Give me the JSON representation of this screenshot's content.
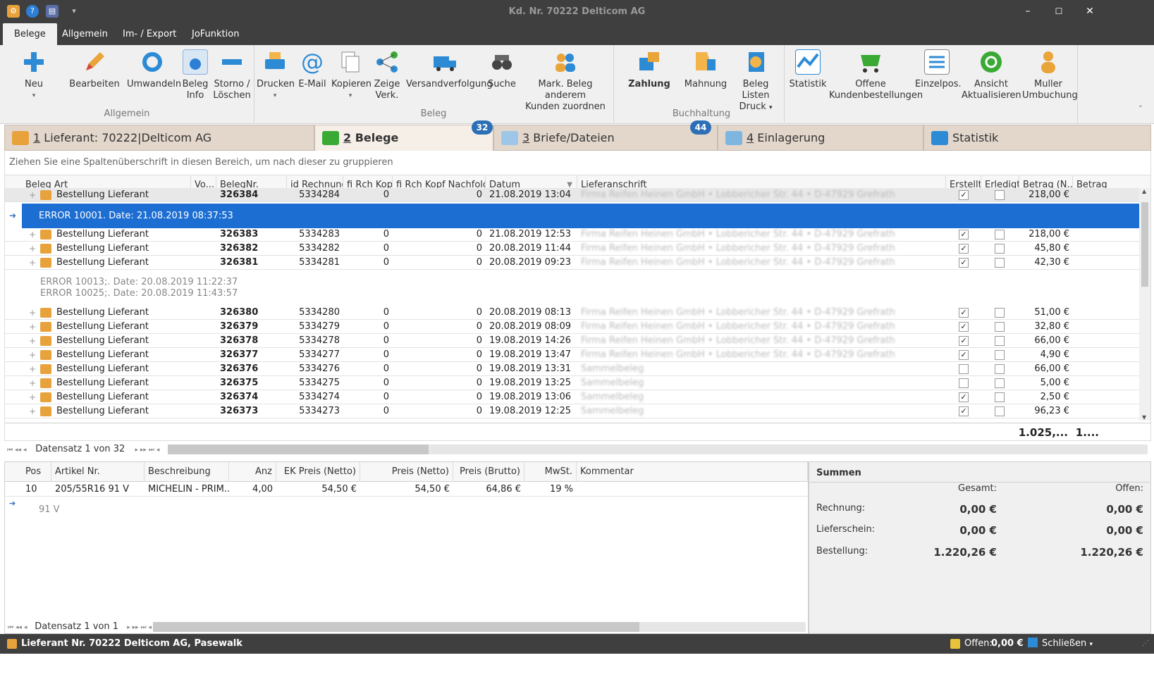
{
  "window": {
    "title": "Kd. Nr. 70222 Delticom AG",
    "minimize": "–",
    "maximize": "☐",
    "close": "✕"
  },
  "menu": {
    "tabs": [
      "Belege",
      "Allgemein",
      "Im- / Export",
      "JoFunktion"
    ]
  },
  "ribbon": {
    "groups": {
      "allgemein": "Allgemein",
      "beleg": "Beleg",
      "buchhaltung": "Buchhaltung"
    },
    "buttons": {
      "neu": "Neu",
      "bearbeiten": "Bearbeiten",
      "umwandeln": "Umwandeln",
      "beleg_info_1": "Beleg",
      "beleg_info_2": "Info",
      "storno_1": "Storno /",
      "storno_2": "Löschen",
      "drucken": "Drucken",
      "email": "E-Mail",
      "kopieren": "Kopieren",
      "zeige_1": "Zeige",
      "zeige_2": "Verk.",
      "versand": "Versandverfolgung",
      "suche": "Suche",
      "mark_1": "Mark. Beleg  anderem",
      "mark_2": "Kunden zuordnen",
      "zahlung": "Zahlung",
      "mahnung": "Mahnung",
      "beleglisten_1": "Beleg Listen",
      "beleglisten_2": "Druck",
      "statistik": "Statistik",
      "offene_1": "Offene",
      "offene_2": "Kundenbestellungen",
      "einzelpos": "Einzelpos.",
      "ansicht_1": "Ansicht",
      "ansicht_2": "Aktualisieren",
      "muller_1": "Muller",
      "muller_2": "Umbuchung"
    }
  },
  "tabs": {
    "t1_num": "1",
    "t1": " Lieferant: 70222|Delticom AG",
    "t2_num": "2",
    "t2": " Belege",
    "t2_badge": "32",
    "t3_num": "3",
    "t3": " Briefe/Dateien",
    "t3_badge": "44",
    "t4_num": "4",
    "t4": " Einlagerung",
    "t5": "Statistik"
  },
  "grid": {
    "group_hint": "Ziehen Sie eine Spaltenüberschrift in diesen Bereich, um nach dieser zu gruppieren",
    "headers": [
      "Beleg Art",
      "Vo...",
      "BelegNr.",
      "id Rechnung",
      "fi Rch Kopf",
      "fi Rch Kopf Nachfolger",
      "Datum",
      "Lieferanschrift",
      "Erstellt",
      "Erledigt",
      "Betrag (N...",
      "Betrag"
    ],
    "address_full": "Firma Reifen Heinen GmbH • Lobbericher Str. 44 • D-47929 Grefrath",
    "address_sammel": "Sammelbeleg",
    "art": "Bestellung Lieferant",
    "error1": "ERROR 10001. Date: 21.08.2019 08:37:53",
    "error2a": "ERROR 10013;. Date: 20.08.2019 11:22:37",
    "error2b": "ERROR 10025;. Date: 20.08.2019 11:43:57",
    "rows": [
      {
        "nr": "326384",
        "rech": "5334284",
        "kopf": "0",
        "nach": "0",
        "datum": "21.08.2019 13:04",
        "betrag": "218,00 €",
        "erstellt": true
      },
      {
        "nr": "326383",
        "rech": "5334283",
        "kopf": "0",
        "nach": "0",
        "datum": "21.08.2019 12:53",
        "betrag": "218,00 €",
        "erstellt": true
      },
      {
        "nr": "326382",
        "rech": "5334282",
        "kopf": "0",
        "nach": "0",
        "datum": "20.08.2019 11:44",
        "betrag": "45,80 €",
        "erstellt": true
      },
      {
        "nr": "326381",
        "rech": "5334281",
        "kopf": "0",
        "nach": "0",
        "datum": "20.08.2019 09:23",
        "betrag": "42,30 €",
        "erstellt": true
      },
      {
        "nr": "326380",
        "rech": "5334280",
        "kopf": "0",
        "nach": "0",
        "datum": "20.08.2019 08:13",
        "betrag": "51,00 €",
        "erstellt": true
      },
      {
        "nr": "326379",
        "rech": "5334279",
        "kopf": "0",
        "nach": "0",
        "datum": "20.08.2019 08:09",
        "betrag": "32,80 €",
        "erstellt": true
      },
      {
        "nr": "326378",
        "rech": "5334278",
        "kopf": "0",
        "nach": "0",
        "datum": "19.08.2019 14:26",
        "betrag": "66,00 €",
        "erstellt": true
      },
      {
        "nr": "326377",
        "rech": "5334277",
        "kopf": "0",
        "nach": "0",
        "datum": "19.08.2019 13:47",
        "betrag": "4,90 €",
        "erstellt": true
      },
      {
        "nr": "326376",
        "rech": "5334276",
        "kopf": "0",
        "nach": "0",
        "datum": "19.08.2019 13:31",
        "betrag": "66,00 €",
        "erstellt": false
      },
      {
        "nr": "326375",
        "rech": "5334275",
        "kopf": "0",
        "nach": "0",
        "datum": "19.08.2019 13:25",
        "betrag": "5,00 €",
        "erstellt": false
      },
      {
        "nr": "326374",
        "rech": "5334274",
        "kopf": "0",
        "nach": "0",
        "datum": "19.08.2019 13:06",
        "betrag": "2,50 €",
        "erstellt": true
      },
      {
        "nr": "326373",
        "rech": "5334273",
        "kopf": "0",
        "nach": "0",
        "datum": "19.08.2019 12:25",
        "betrag": "96,23 €",
        "erstellt": true
      }
    ],
    "sum1": "1.025,...",
    "sum2": "1....",
    "nav": "Datensatz 1 von 32"
  },
  "positions": {
    "headers": [
      "Pos",
      "Artikel Nr.",
      "Beschreibung",
      "Anz",
      "EK Preis (Netto)",
      "Preis (Netto)",
      "Preis (Brutto)",
      "MwSt.",
      "Kommentar"
    ],
    "row": {
      "pos": "10",
      "artikel": "205/55R16 91 V",
      "beschreibung": "MICHELIN - PRIM...",
      "anz": "4,00",
      "ek": "54,50 €",
      "netto": "54,50 €",
      "brutto": "64,86 €",
      "mwst": "19 %",
      "kommentar": ""
    },
    "detail": "91 V",
    "nav": "Datensatz 1 von 1"
  },
  "summen": {
    "title": "Summen",
    "gesamt": "Gesamt:",
    "offen": "Offen:",
    "rechnung": "Rechnung:",
    "rechnung_g": "0,00 €",
    "rechnung_o": "0,00 €",
    "lieferschein": "Lieferschein:",
    "lieferschein_g": "0,00 €",
    "lieferschein_o": "0,00 €",
    "bestellung": "Bestellung:",
    "bestellung_g": "1.220,26 €",
    "bestellung_o": "1.220,26 €"
  },
  "status": {
    "left": "Lieferant Nr. 70222 Delticom AG, Pasewalk",
    "offen_label": "Offen:",
    "offen_value": "0,00 €",
    "schliessen": "Schließen"
  }
}
